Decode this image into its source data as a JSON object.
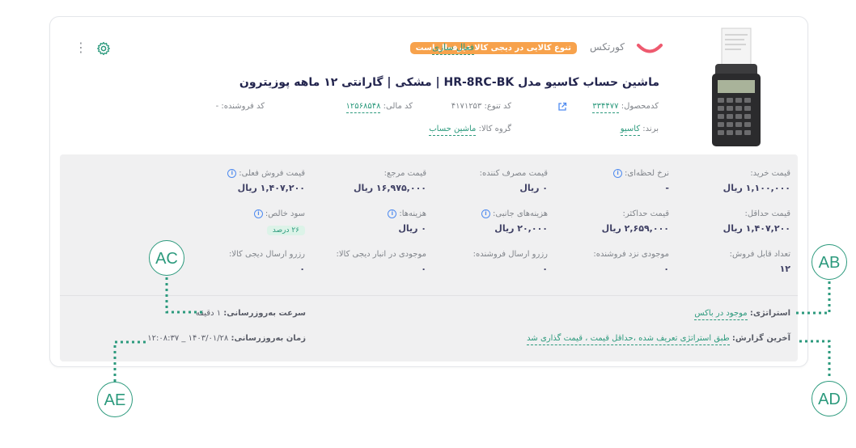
{
  "header": {
    "brand_name": "کورتکس",
    "warning_badge": "تنوع کالایی در دیجی کالا غیرفعال است",
    "activate_link": "فعال سازی",
    "product_title": "ماشین حساب کاسیو مدل HR-8RC-BK | مشکی | گارانتی ۱۲ ماهه پوزیترون",
    "seller_code_label": "کد فروشنده:",
    "seller_code_value": "-",
    "financial_code_label": "کد مالی:",
    "financial_code_value": "۱۲۵۶۸۵۴۸",
    "variant_code_label": "کد تنوع:",
    "variant_code_value": "۴۱۷۱۲۵۳",
    "product_code_label": "کدمحصول:",
    "product_code_value": "۳۳۴۴۷۷",
    "category_label": "گروه کالا:",
    "category_value": "ماشین حساب",
    "brand_label": "برند:",
    "brand_value": "کاسیو"
  },
  "grid": [
    [
      {
        "label": "قیمت خرید:",
        "value": "۱,۱۰۰,۰۰۰ ریال",
        "info": false
      },
      {
        "label": "نرخ لحظه‌ای:",
        "value": "-",
        "info": true
      },
      {
        "label": "قیمت مصرف کننده:",
        "value": "۰ ریال",
        "info": false
      },
      {
        "label": "قیمت مرجع:",
        "value": "۱۶,۹۷۵,۰۰۰ ریال",
        "info": false
      },
      {
        "label": "قیمت فروش فعلی:",
        "value": "۱,۴۰۷,۲۰۰ ریال",
        "info": true
      }
    ],
    [
      {
        "label": "قیمت حداقل:",
        "value": "۱,۴۰۷,۲۰۰ ریال",
        "info": false
      },
      {
        "label": "قیمت حداکثر:",
        "value": "۲,۶۵۹,۰۰۰ ریال",
        "info": false
      },
      {
        "label": "هزینه‌های جانبی:",
        "value": "۲۰,۰۰۰ ریال",
        "info": true
      },
      {
        "label": "هزینه‌ها:",
        "value": "۰ ریال",
        "info": true
      },
      {
        "label": "سود خالص:",
        "value": "۲۶ درصد",
        "info": true,
        "badge": true
      }
    ],
    [
      {
        "label": "تعداد قابل فروش:",
        "value": "۱۲",
        "info": false
      },
      {
        "label": "موجودی نزد فروشنده:",
        "value": "۰",
        "info": false
      },
      {
        "label": "رزرو ارسال فروشنده:",
        "value": "۰",
        "info": false
      },
      {
        "label": "موجودی در انبار دیجی کالا:",
        "value": "۰",
        "info": false
      },
      {
        "label": "رزرو ارسال دیجی کالا:",
        "value": "۰",
        "info": false
      }
    ]
  ],
  "footer": {
    "strategy_label": "استراتژی:",
    "strategy_value": "موجود در باکس",
    "last_report_label": "آخرین گزارش:",
    "last_report_value": "طبق استراتژی تعریف شده ،حداقل قیمت ، قیمت گذاری شد",
    "update_speed_label": "سرعت به‌روزرسانی:",
    "update_speed_value": "۱ دقیقه",
    "update_time_label": "زمان به‌روزرسانی:",
    "update_time_value": "۱۴۰۳/۰۱/۲۸ _ ۱۲:۰۸:۳۷"
  },
  "callouts": {
    "ab": "AB",
    "ac": "AC",
    "ad": "AD",
    "ae": "AE"
  },
  "colors": {
    "accent": "#2c9a7d",
    "warning": "#f7a24c",
    "panel": "#f0f0f1",
    "info": "#4f8bf0",
    "logo": "#ee5a6f"
  },
  "icons": [
    "kebab-menu-icon",
    "gear-icon",
    "external-link-icon",
    "info-icon",
    "brand-logo-icon"
  ]
}
